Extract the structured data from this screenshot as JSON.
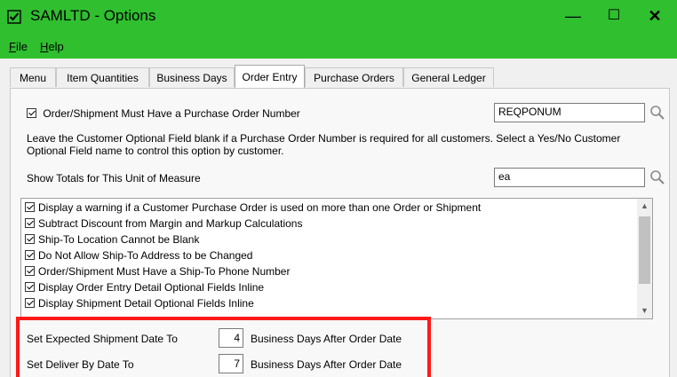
{
  "window": {
    "title": "SAMLTD - Options",
    "minimize_glyph": "—",
    "maximize_glyph": "☐",
    "close_glyph": "✕"
  },
  "menu": {
    "file_accel": "F",
    "file_rest": "ile",
    "help_accel": "H",
    "help_rest": "elp"
  },
  "tabs": [
    "Menu",
    "Item Quantities",
    "Business Days",
    "Order Entry",
    "Purchase Orders",
    "General Ledger"
  ],
  "active_tab": "Order Entry",
  "order_entry": {
    "po_required": {
      "label": "Order/Shipment Must Have a Purchase Order Number",
      "checked": true,
      "field_value": "REQPONUM"
    },
    "po_help": "Leave the Customer Optional Field blank if a Purchase Order Number is required for all customers. Select a Yes/No Customer Optional Field name to control this option by customer.",
    "totals_uom": {
      "label": "Show Totals for This Unit of Measure",
      "value": "ea"
    },
    "options": [
      {
        "label": "Display a warning if a Customer Purchase Order is used on more than one Order or Shipment",
        "checked": true
      },
      {
        "label": "Subtract Discount from Margin and Markup Calculations",
        "checked": true
      },
      {
        "label": "Ship-To Location Cannot be Blank",
        "checked": true
      },
      {
        "label": "Do Not Allow Ship-To Address to be Changed",
        "checked": true
      },
      {
        "label": "Order/Shipment Must Have a Ship-To Phone Number",
        "checked": true
      },
      {
        "label": "Display Order Entry Detail Optional Fields Inline",
        "checked": true
      },
      {
        "label": "Display Shipment Detail Optional Fields Inline",
        "checked": true
      }
    ],
    "expected_ship": {
      "label": "Set Expected Shipment Date To",
      "value": "4",
      "suffix": "Business Days After Order Date"
    },
    "deliver_by": {
      "label": "Set Deliver By Date To",
      "value": "7",
      "suffix": "Business Days After Order Date"
    }
  },
  "colors": {
    "title_bar": "#2fbf2f",
    "highlight_box": "#ff1a1a"
  }
}
